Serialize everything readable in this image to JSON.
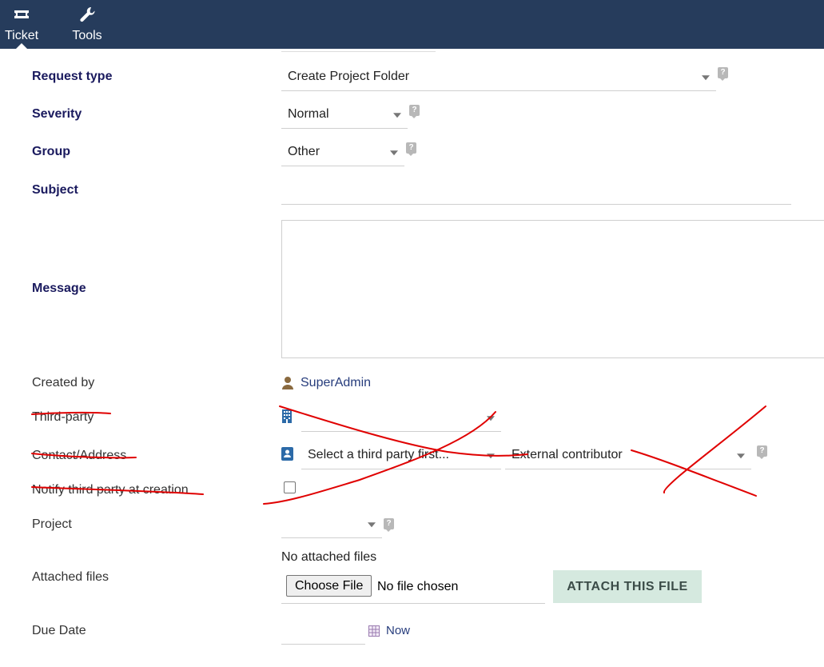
{
  "topnav": {
    "items": [
      {
        "label": "Ticket",
        "icon": "ticket-icon",
        "active": true
      },
      {
        "label": "Tools",
        "icon": "wrench-icon",
        "active": false
      }
    ]
  },
  "form": {
    "request_type": {
      "label": "Request type",
      "value": "Create Project Folder"
    },
    "severity": {
      "label": "Severity",
      "value": "Normal"
    },
    "group": {
      "label": "Group",
      "value": "Other"
    },
    "subject": {
      "label": "Subject",
      "value": ""
    },
    "message": {
      "label": "Message",
      "value": ""
    },
    "created_by": {
      "label": "Created by",
      "value": "SuperAdmin"
    },
    "third_party": {
      "label": "Third-party",
      "value": ""
    },
    "contact_address": {
      "label": "Contact/Address",
      "value": "Select a third party first...",
      "role_value": "External contributor"
    },
    "notify": {
      "label": "Notify third party at creation",
      "checked": false
    },
    "project": {
      "label": "Project",
      "value": ""
    },
    "attached_files": {
      "label": "Attached files",
      "status": "No attached files",
      "choose_label": "Choose File",
      "chosen_text": "No file chosen",
      "attach_label": "ATTACH THIS FILE"
    },
    "due_date": {
      "label": "Due Date",
      "value": "",
      "now_label": "Now"
    }
  },
  "colors": {
    "topbar": "#263c5c",
    "required_label": "#1a1a5e",
    "link": "#263c7c",
    "attach_button_bg": "#d5e9df",
    "annotation_red": "#e00000"
  },
  "help_icon": "?"
}
